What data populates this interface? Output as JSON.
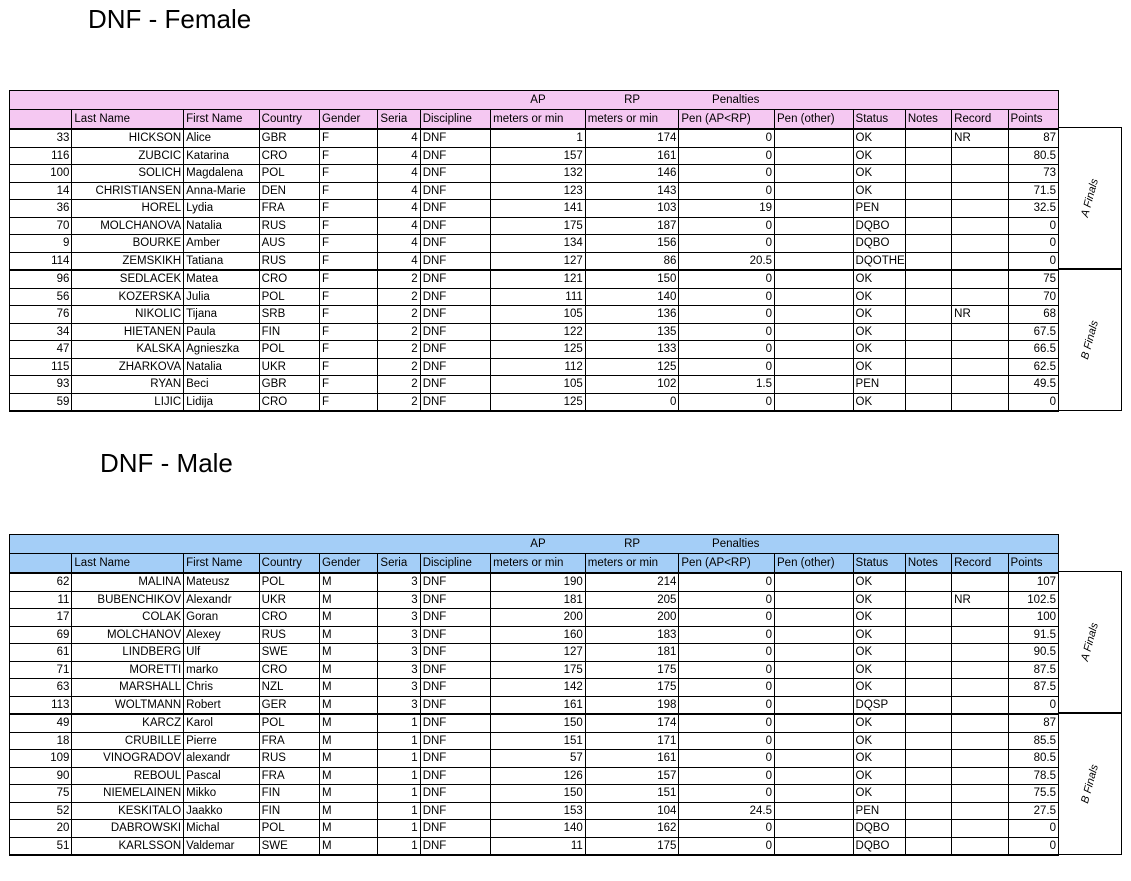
{
  "female": {
    "title": "DNF - Female",
    "header_color": "#f5c8f2",
    "top_header": {
      "ap": "AP",
      "rp": "RP",
      "penalties": "Penalties"
    },
    "columns": [
      "",
      "Last Name",
      "First Name",
      "Country",
      "Gender",
      "Seria",
      "Discipline",
      "meters or min",
      "meters or min",
      "Pen (AP<RP)",
      "Pen (other)",
      "Status",
      "Notes",
      "Record",
      "Points"
    ],
    "groups": [
      "A Finals",
      "B Finals"
    ],
    "rows": [
      [
        "33",
        "HICKSON",
        "Alice",
        "GBR",
        "F",
        "4",
        "DNF",
        "1",
        "174",
        "0",
        "",
        "OK",
        "",
        "NR",
        "87"
      ],
      [
        "116",
        "ZUBCIC",
        "Katarina",
        "CRO",
        "F",
        "4",
        "DNF",
        "157",
        "161",
        "0",
        "",
        "OK",
        "",
        "",
        "80.5"
      ],
      [
        "100",
        "SOLICH",
        "Magdalena",
        "POL",
        "F",
        "4",
        "DNF",
        "132",
        "146",
        "0",
        "",
        "OK",
        "",
        "",
        "73"
      ],
      [
        "14",
        "CHRISTIANSEN",
        "Anna-Marie",
        "DEN",
        "F",
        "4",
        "DNF",
        "123",
        "143",
        "0",
        "",
        "OK",
        "",
        "",
        "71.5"
      ],
      [
        "36",
        "HOREL",
        "Lydia",
        "FRA",
        "F",
        "4",
        "DNF",
        "141",
        "103",
        "19",
        "",
        "PEN",
        "",
        "",
        "32.5"
      ],
      [
        "70",
        "MOLCHANOVA",
        "Natalia",
        "RUS",
        "F",
        "4",
        "DNF",
        "175",
        "187",
        "0",
        "",
        "DQBO",
        "",
        "",
        "0"
      ],
      [
        "9",
        "BOURKE",
        "Amber",
        "AUS",
        "F",
        "4",
        "DNF",
        "134",
        "156",
        "0",
        "",
        "DQBO",
        "",
        "",
        "0"
      ],
      [
        "114",
        "ZEMSKIKH",
        "Tatiana",
        "RUS",
        "F",
        "4",
        "DNF",
        "127",
        "86",
        "20.5",
        "",
        "DQOTHER",
        "",
        "",
        "0"
      ],
      [
        "96",
        "SEDLACEK",
        "Matea",
        "CRO",
        "F",
        "2",
        "DNF",
        "121",
        "150",
        "0",
        "",
        "OK",
        "",
        "",
        "75"
      ],
      [
        "56",
        "KOZERSKA",
        "Julia",
        "POL",
        "F",
        "2",
        "DNF",
        "111",
        "140",
        "0",
        "",
        "OK",
        "",
        "",
        "70"
      ],
      [
        "76",
        "NIKOLIC",
        "Tijana",
        "SRB",
        "F",
        "2",
        "DNF",
        "105",
        "136",
        "0",
        "",
        "OK",
        "",
        "NR",
        "68"
      ],
      [
        "34",
        "HIETANEN",
        "Paula",
        "FIN",
        "F",
        "2",
        "DNF",
        "122",
        "135",
        "0",
        "",
        "OK",
        "",
        "",
        "67.5"
      ],
      [
        "47",
        "KALSKA",
        "Agnieszka",
        "POL",
        "F",
        "2",
        "DNF",
        "125",
        "133",
        "0",
        "",
        "OK",
        "",
        "",
        "66.5"
      ],
      [
        "115",
        "ZHARKOVA",
        "Natalia",
        "UKR",
        "F",
        "2",
        "DNF",
        "112",
        "125",
        "0",
        "",
        "OK",
        "",
        "",
        "62.5"
      ],
      [
        "93",
        "RYAN",
        "Beci",
        "GBR",
        "F",
        "2",
        "DNF",
        "105",
        "102",
        "1.5",
        "",
        "PEN",
        "",
        "",
        "49.5"
      ],
      [
        "59",
        "LIJIC",
        "Lidija",
        "CRO",
        "F",
        "2",
        "DNF",
        "125",
        "0",
        "0",
        "",
        "OK",
        "",
        "",
        "0"
      ]
    ]
  },
  "male": {
    "title": "DNF - Male",
    "header_color": "#a4cef7",
    "top_header": {
      "ap": "AP",
      "rp": "RP",
      "penalties": "Penalties"
    },
    "columns": [
      "",
      "Last Name",
      "First Name",
      "Country",
      "Gender",
      "Seria",
      "Discipline",
      "meters or min",
      "meters or min",
      "Pen (AP<RP)",
      "Pen (other)",
      "Status",
      "Notes",
      "Record",
      "Points"
    ],
    "groups": [
      "A Finals",
      "B Finals"
    ],
    "rows": [
      [
        "62",
        "MALINA",
        "Mateusz",
        "POL",
        "M",
        "3",
        "DNF",
        "190",
        "214",
        "0",
        "",
        "OK",
        "",
        "",
        "107"
      ],
      [
        "11",
        "BUBENCHIKOV",
        "Alexandr",
        "UKR",
        "M",
        "3",
        "DNF",
        "181",
        "205",
        "0",
        "",
        "OK",
        "",
        "NR",
        "102.5"
      ],
      [
        "17",
        "COLAK",
        "Goran",
        "CRO",
        "M",
        "3",
        "DNF",
        "200",
        "200",
        "0",
        "",
        "OK",
        "",
        "",
        "100"
      ],
      [
        "69",
        "MOLCHANOV",
        "Alexey",
        "RUS",
        "M",
        "3",
        "DNF",
        "160",
        "183",
        "0",
        "",
        "OK",
        "",
        "",
        "91.5"
      ],
      [
        "61",
        "LINDBERG",
        "Ulf",
        "SWE",
        "M",
        "3",
        "DNF",
        "127",
        "181",
        "0",
        "",
        "OK",
        "",
        "",
        "90.5"
      ],
      [
        "71",
        "MORETTI",
        "marko",
        "CRO",
        "M",
        "3",
        "DNF",
        "175",
        "175",
        "0",
        "",
        "OK",
        "",
        "",
        "87.5"
      ],
      [
        "63",
        "MARSHALL",
        "Chris",
        "NZL",
        "M",
        "3",
        "DNF",
        "142",
        "175",
        "0",
        "",
        "OK",
        "",
        "",
        "87.5"
      ],
      [
        "113",
        "WOLTMANN",
        "Robert",
        "GER",
        "M",
        "3",
        "DNF",
        "161",
        "198",
        "0",
        "",
        "DQSP",
        "",
        "",
        "0"
      ],
      [
        "49",
        "KARCZ",
        "Karol",
        "POL",
        "M",
        "1",
        "DNF",
        "150",
        "174",
        "0",
        "",
        "OK",
        "",
        "",
        "87"
      ],
      [
        "18",
        "CRUBILLE",
        "Pierre",
        "FRA",
        "M",
        "1",
        "DNF",
        "151",
        "171",
        "0",
        "",
        "OK",
        "",
        "",
        "85.5"
      ],
      [
        "109",
        "VINOGRADOV",
        "alexandr",
        "RUS",
        "M",
        "1",
        "DNF",
        "57",
        "161",
        "0",
        "",
        "OK",
        "",
        "",
        "80.5"
      ],
      [
        "90",
        "REBOUL",
        "Pascal",
        "FRA",
        "M",
        "1",
        "DNF",
        "126",
        "157",
        "0",
        "",
        "OK",
        "",
        "",
        "78.5"
      ],
      [
        "75",
        "NIEMELAINEN",
        "Mikko",
        "FIN",
        "M",
        "1",
        "DNF",
        "150",
        "151",
        "0",
        "",
        "OK",
        "",
        "",
        "75.5"
      ],
      [
        "52",
        "KESKITALO",
        "Jaakko",
        "FIN",
        "M",
        "1",
        "DNF",
        "153",
        "104",
        "24.5",
        "",
        "PEN",
        "",
        "",
        "27.5"
      ],
      [
        "20",
        "DABROWSKI",
        "Michal",
        "POL",
        "M",
        "1",
        "DNF",
        "140",
        "162",
        "0",
        "",
        "DQBO",
        "",
        "",
        "0"
      ],
      [
        "51",
        "KARLSSON",
        "Valdemar",
        "SWE",
        "M",
        "1",
        "DNF",
        "11",
        "175",
        "0",
        "",
        "DQBO",
        "",
        "",
        "0"
      ]
    ]
  }
}
